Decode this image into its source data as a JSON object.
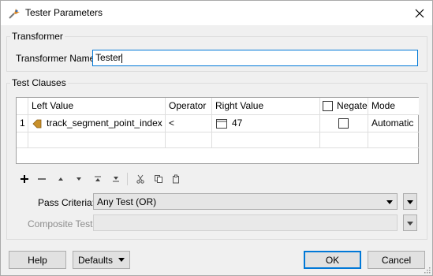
{
  "window": {
    "title": "Tester Parameters"
  },
  "transformer_group": {
    "label": "Transformer",
    "name_label": "Transformer Name:",
    "name_value": "Tester"
  },
  "test_clauses_group": {
    "label": "Test Clauses",
    "columns": {
      "left_value": "Left Value",
      "operator": "Operator",
      "right_value": "Right Value",
      "negate": "Negate",
      "mode": "Mode"
    },
    "rows": [
      {
        "index": "1",
        "left_value": "track_segment_point_index",
        "operator": "<",
        "right_value": "47",
        "negate": false,
        "mode": "Automatic"
      }
    ],
    "toolbar_icons": [
      "add-icon",
      "remove-icon",
      "move-up-icon",
      "move-down-icon",
      "move-top-icon",
      "move-bottom-icon",
      "cut-icon",
      "copy-icon",
      "paste-icon"
    ],
    "pass_criteria_label": "Pass Criteria:",
    "pass_criteria_value": "Any Test (OR)",
    "composite_test_label": "Composite Test:",
    "composite_test_value": ""
  },
  "footer": {
    "help_label": "Help",
    "defaults_label": "Defaults",
    "ok_label": "OK",
    "cancel_label": "Cancel"
  },
  "colors": {
    "focus_border": "#0078d7",
    "attribute_icon": "#c8902a",
    "window_bg": "#f0f0f0"
  }
}
